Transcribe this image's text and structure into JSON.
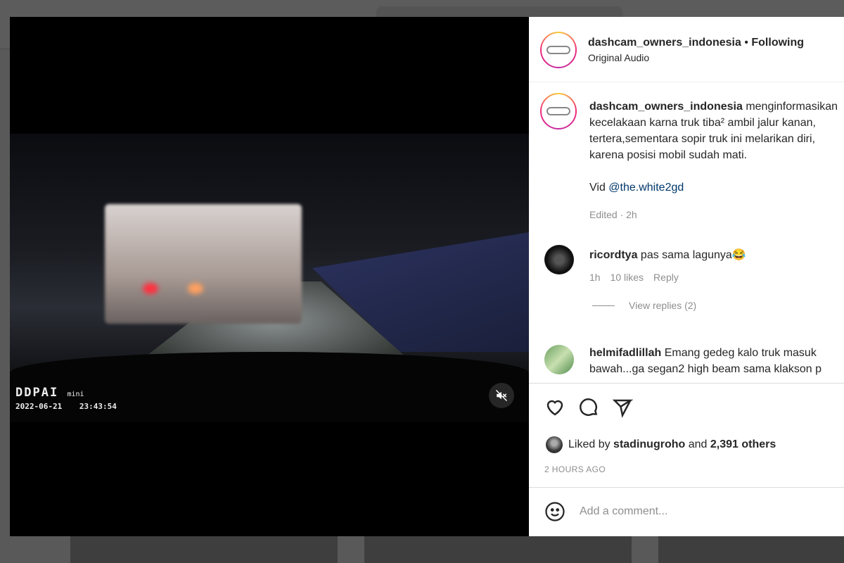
{
  "video": {
    "camera_brand": "DDPAI",
    "camera_model": "mini",
    "date": "2022-06-21",
    "time": "23:43:54",
    "mute_icon": "speaker-muted-icon"
  },
  "header": {
    "username": "dashcam_owners_indonesia",
    "bullet": "•",
    "follow_status": "Following",
    "audio": "Original Audio"
  },
  "caption": {
    "username": "dashcam_owners_indonesia",
    "lines": [
      "menginformasikan",
      "kecelakaan karna truk tiba² ambil jalur kanan,",
      "tertera,sementara sopir truk ini melarikan diri,",
      "karena posisi mobil sudah mati."
    ],
    "vid_prefix": "Vid",
    "mention": "@the.white2gd",
    "meta": "Edited · 2h"
  },
  "comments": [
    {
      "username": "ricordtya",
      "text": "pas sama lagunya😂",
      "time": "1h",
      "likes": "10 likes",
      "reply": "Reply",
      "view_replies": "View replies (2)"
    },
    {
      "username": "helmifadlillah",
      "text_lines": [
        "Emang gedeg kalo truk masuk",
        "bawah...ga segan2 high beam sama klakson p"
      ]
    }
  ],
  "likes": {
    "prefix": "Liked by",
    "user": "stadinugroho",
    "middle": "and",
    "count": "2,391 others"
  },
  "timestamp": "2 HOURS AGO",
  "comment_input": {
    "placeholder": "Add a comment..."
  }
}
